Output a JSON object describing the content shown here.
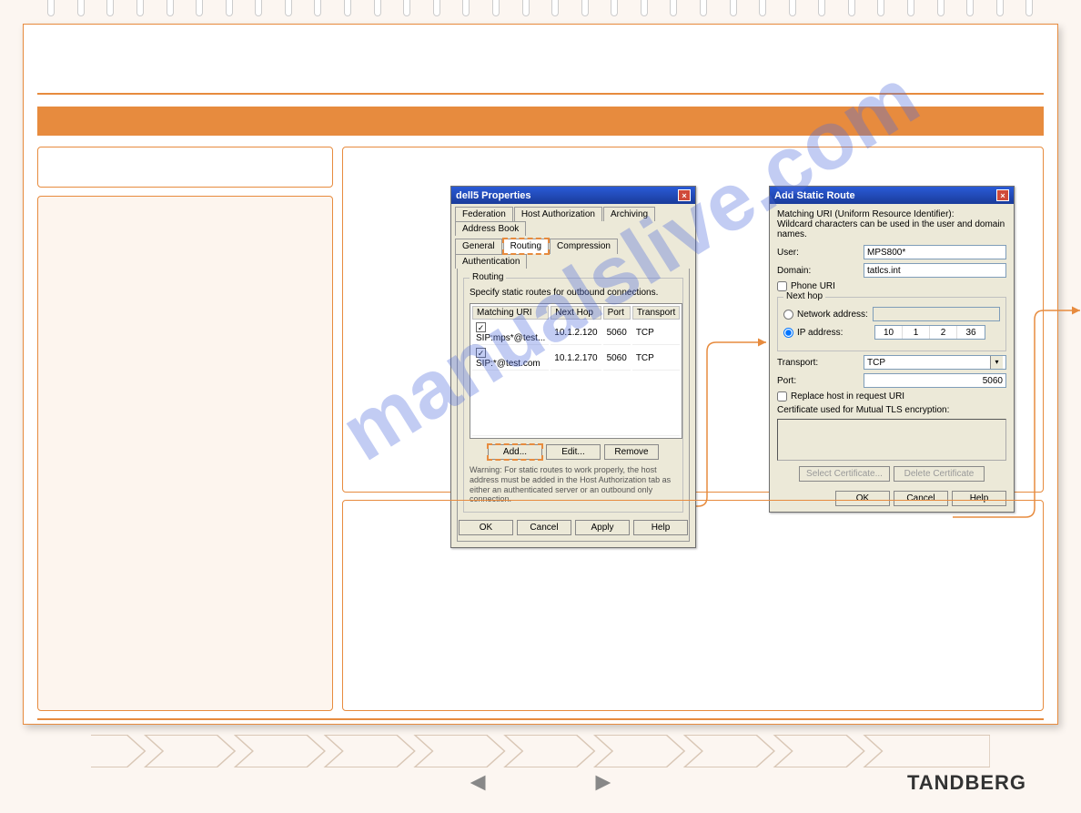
{
  "watermark": "manualslive.com",
  "logo": "TANDBERG",
  "dlg1": {
    "title": "dell5 Properties",
    "tabs_row1": [
      "Federation",
      "Host Authorization",
      "Archiving",
      "Address Book"
    ],
    "tabs_row2": [
      "General",
      "Routing",
      "Compression",
      "Authentication"
    ],
    "group_legend": "Routing",
    "instr": "Specify static routes for outbound connections.",
    "headers": [
      "Matching URI",
      "Next Hop",
      "Port",
      "Transport"
    ],
    "rows": [
      {
        "uri": "SIP:mps*@test...",
        "hop": "10.1.2.120",
        "port": "5060",
        "tr": "TCP"
      },
      {
        "uri": "SIP:*@test.com",
        "hop": "10.1.2.170",
        "port": "5060",
        "tr": "TCP"
      }
    ],
    "btn_add": "Add...",
    "btn_edit": "Edit...",
    "btn_remove": "Remove",
    "warning": "Warning: For static routes to work properly, the host address must be added in the Host Authorization tab as either an authenticated server or an outbound only connection.",
    "btn_ok": "OK",
    "btn_cancel": "Cancel",
    "btn_apply": "Apply",
    "btn_help": "Help"
  },
  "dlg2": {
    "title": "Add Static Route",
    "hdr": "Matching URI (Uniform Resource Identifier):",
    "sub": "Wildcard characters can be used in the user and domain names.",
    "lbl_user": "User:",
    "val_user": "MPS800*",
    "lbl_domain": "Domain:",
    "val_domain": "tatlcs.int",
    "lbl_phone": "Phone URI",
    "grp_next": "Next hop",
    "lbl_net": "Network address:",
    "lbl_ip": "IP address:",
    "ip": [
      "10",
      "1",
      "2",
      "36"
    ],
    "lbl_transport": "Transport:",
    "val_transport": "TCP",
    "lbl_port": "Port:",
    "val_port": "5060",
    "lbl_replace": "Replace host in request URI",
    "lbl_cert": "Certificate used for Mutual TLS encryption:",
    "btn_sel": "Select Certificate...",
    "btn_del": "Delete Certificate",
    "btn_ok": "OK",
    "btn_cancel": "Cancel",
    "btn_help": "Help"
  }
}
